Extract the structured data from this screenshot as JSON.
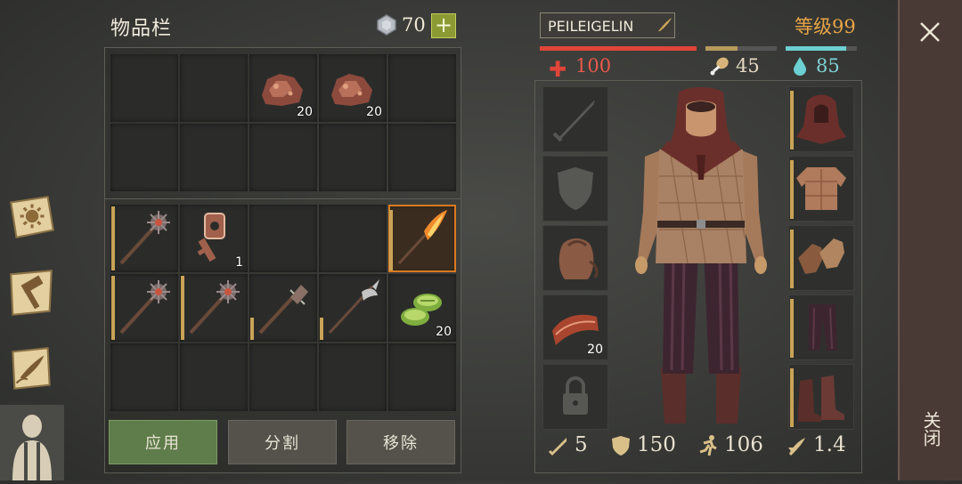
{
  "inventory": {
    "title": "物品栏",
    "currency": {
      "icon": "gem-icon",
      "count": "70",
      "add_label": "+"
    },
    "grid_top": [
      {
        "item": "empty"
      },
      {
        "item": "empty"
      },
      {
        "item": "copper-ore",
        "count": "20"
      },
      {
        "item": "copper-ore",
        "count": "20"
      },
      {
        "item": "empty"
      },
      {
        "item": "empty"
      },
      {
        "item": "empty"
      },
      {
        "item": "empty"
      },
      {
        "item": "empty"
      },
      {
        "item": "empty"
      }
    ],
    "grid_bottom": [
      {
        "item": "mace",
        "durability": 1.0
      },
      {
        "item": "key",
        "count": "1"
      },
      {
        "item": "empty"
      },
      {
        "item": "empty"
      },
      {
        "item": "flaming-spear",
        "selected": true,
        "durability": 0.95
      },
      {
        "item": "mace",
        "durability": 1.0
      },
      {
        "item": "mace",
        "durability": 1.0
      },
      {
        "item": "spiked-club",
        "durability": 0.35
      },
      {
        "item": "halberd",
        "durability": 0.35
      },
      {
        "item": "cactus-slices",
        "count": "20"
      },
      {
        "item": "empty"
      },
      {
        "item": "empty"
      },
      {
        "item": "empty"
      },
      {
        "item": "empty"
      },
      {
        "item": "empty"
      }
    ],
    "buttons": {
      "apply": "应用",
      "split": "分割",
      "remove": "移除"
    }
  },
  "character": {
    "name": "PEILEIGELIN",
    "level": "等级99",
    "health": "100",
    "food": "45",
    "water": "85",
    "health_fill": 1.0,
    "food_fill": 0.45,
    "water_fill": 0.85,
    "left_slots": [
      {
        "item": "sword-slot-icon"
      },
      {
        "item": "shield-slot-icon"
      },
      {
        "item": "backpack"
      },
      {
        "item": "meat",
        "count": "20"
      },
      {
        "item": "lock-icon"
      }
    ],
    "right_slots": [
      {
        "item": "hood"
      },
      {
        "item": "gambeson"
      },
      {
        "item": "gloves"
      },
      {
        "item": "pants"
      },
      {
        "item": "boots"
      }
    ],
    "stats": [
      {
        "icon": "attack-icon",
        "value": "5"
      },
      {
        "icon": "armor-icon",
        "value": "150"
      },
      {
        "icon": "speed-icon",
        "value": "106"
      },
      {
        "icon": "weight-icon",
        "value": "1.4"
      }
    ]
  },
  "close": {
    "label": "关闭"
  },
  "colors": {
    "health": "#e0453a",
    "food": "#b89a5f",
    "water": "#6ccfd2",
    "level": "#e7a447",
    "selected": "#d97a1f"
  }
}
